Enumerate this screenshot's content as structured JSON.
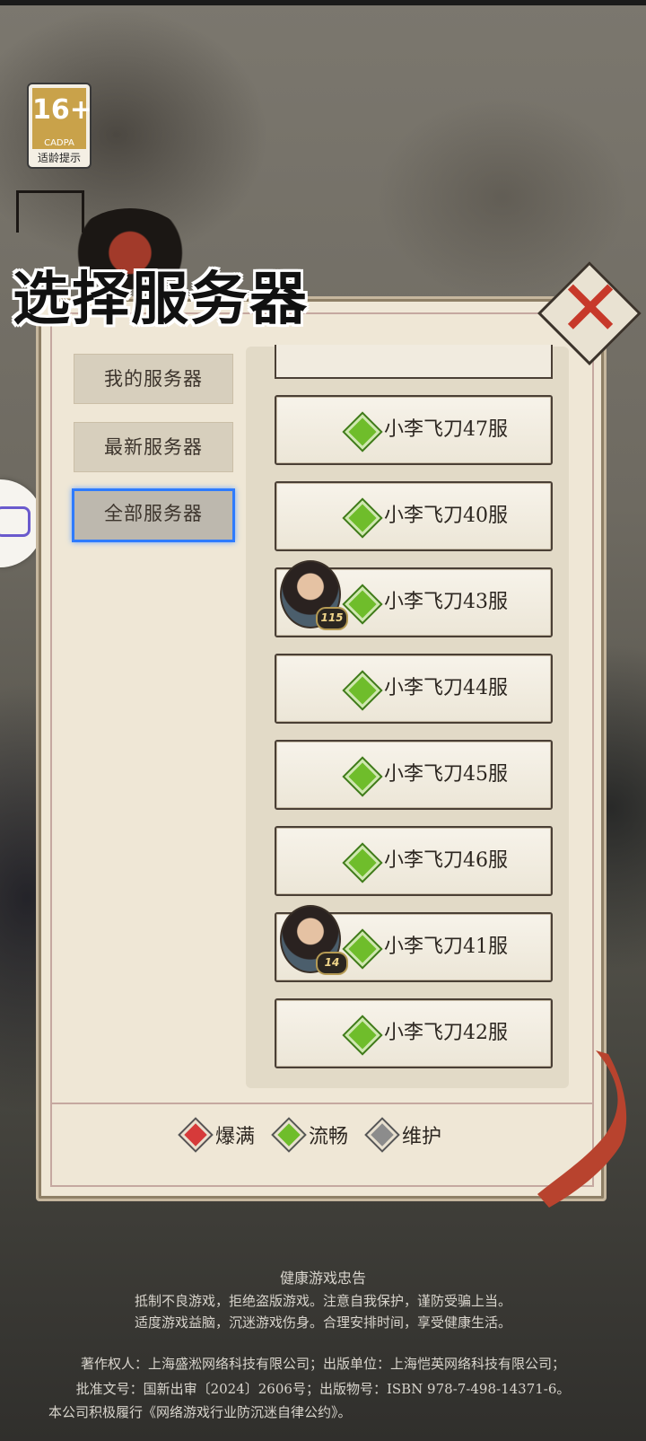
{
  "age_rating": {
    "value": "16+",
    "org": "CADPA",
    "tip": "适龄提示"
  },
  "title": "选择服务器",
  "tabs": [
    {
      "label": "我的服务器",
      "active": false
    },
    {
      "label": "最新服务器",
      "active": false
    },
    {
      "label": "全部服务器",
      "active": true
    }
  ],
  "servers": [
    {
      "name": "小李飞刀47服",
      "status": "流畅",
      "avatar_level": null
    },
    {
      "name": "小李飞刀40服",
      "status": "流畅",
      "avatar_level": null
    },
    {
      "name": "小李飞刀43服",
      "status": "流畅",
      "avatar_level": "115"
    },
    {
      "name": "小李飞刀44服",
      "status": "流畅",
      "avatar_level": null
    },
    {
      "name": "小李飞刀45服",
      "status": "流畅",
      "avatar_level": null
    },
    {
      "name": "小李飞刀46服",
      "status": "流畅",
      "avatar_level": null
    },
    {
      "name": "小李飞刀41服",
      "status": "流畅",
      "avatar_level": "14"
    },
    {
      "name": "小李飞刀42服",
      "status": "流畅",
      "avatar_level": null
    }
  ],
  "legend": [
    {
      "label": "爆满",
      "color": "#d63a3a"
    },
    {
      "label": "流畅",
      "color": "#6fbd2b"
    },
    {
      "label": "维护",
      "color": "#8c8c8c"
    }
  ],
  "footer": {
    "title": "健康游戏忠告",
    "advice_1": "抵制不良游戏，拒绝盗版游戏。注意自我保护，谨防受骗上当。",
    "advice_2": "适度游戏益脑，沉迷游戏伤身。合理安排时间，享受健康生活。",
    "copyright": "著作权人：上海盛淞网络科技有限公司；出版单位：上海恺英网络科技有限公司；",
    "approval": "批准文号：国新出审〔2024〕2606号；出版物号：ISBN 978-7-498-14371-6。",
    "pledge": "本公司积极履行《网络游戏行业防沉迷自律公约》。"
  }
}
